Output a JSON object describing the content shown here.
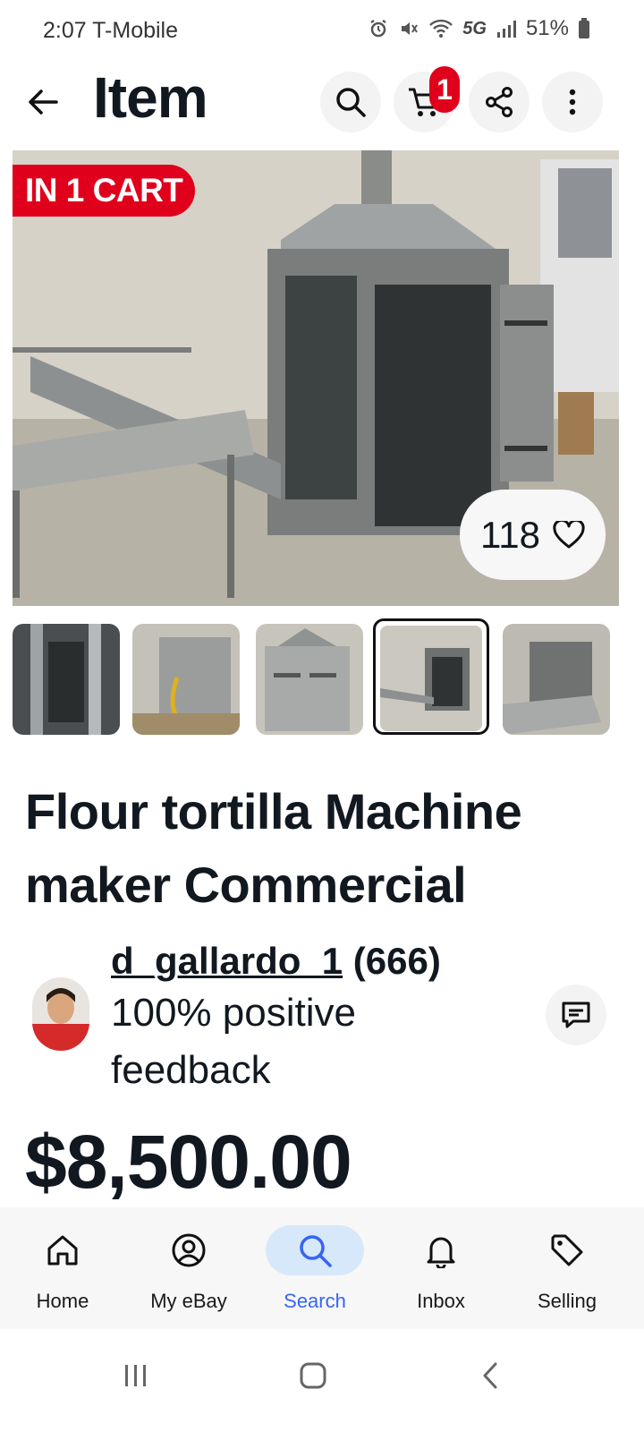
{
  "status_bar": {
    "time_carrier": "2:07 T-Mobile",
    "network": "5G",
    "battery": "51%"
  },
  "header": {
    "title": "Item",
    "cart_count": "1",
    "icons": [
      "back-arrow-icon",
      "search-icon",
      "cart-icon",
      "share-icon",
      "more-vertical-icon"
    ]
  },
  "hero": {
    "cart_badge": "IN 1 CART",
    "watch_count": "118"
  },
  "thumbnails": {
    "count": 5,
    "selected_index": 3
  },
  "listing": {
    "title": "Flour tortilla Machine maker Commercial",
    "price": "$8,500.00"
  },
  "seller": {
    "username": "d_gallardo_1",
    "score": "(666)",
    "feedback": "100% positive feedback"
  },
  "bottom_nav": {
    "items": [
      {
        "label": "Home",
        "icon": "home-icon"
      },
      {
        "label": "My eBay",
        "icon": "profile-icon"
      },
      {
        "label": "Search",
        "icon": "search-icon"
      },
      {
        "label": "Inbox",
        "icon": "bell-icon"
      },
      {
        "label": "Selling",
        "icon": "tag-icon"
      }
    ],
    "active": "Search"
  },
  "colors": {
    "accent_blue": "#3665f3",
    "badge_red": "#e0001c",
    "text": "#111820"
  }
}
